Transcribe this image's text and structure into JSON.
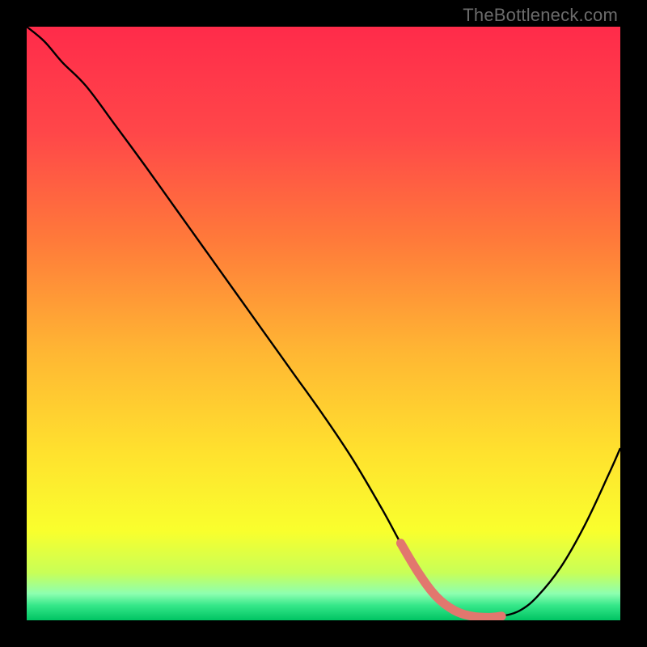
{
  "watermark": "TheBottleneck.com",
  "colors": {
    "background": "#000000",
    "curve": "#000000",
    "highlight": "#e2776e",
    "gradient_stops": [
      {
        "offset": 0.0,
        "color": "#ff2b4a"
      },
      {
        "offset": 0.18,
        "color": "#ff4749"
      },
      {
        "offset": 0.36,
        "color": "#ff7a3a"
      },
      {
        "offset": 0.55,
        "color": "#ffb733"
      },
      {
        "offset": 0.72,
        "color": "#ffe22e"
      },
      {
        "offset": 0.85,
        "color": "#f9ff2d"
      },
      {
        "offset": 0.92,
        "color": "#c8ff57"
      },
      {
        "offset": 0.955,
        "color": "#8dffb0"
      },
      {
        "offset": 0.975,
        "color": "#35e789"
      },
      {
        "offset": 1.0,
        "color": "#00c463"
      }
    ],
    "watermark_text": "#6b6b6b"
  },
  "chart_data": {
    "type": "line",
    "title": "",
    "xlabel": "",
    "ylabel": "",
    "xlim": [
      0,
      100
    ],
    "ylim": [
      0,
      100
    ],
    "series": [
      {
        "name": "curve",
        "x": [
          0,
          3,
          6,
          10,
          15,
          20,
          25,
          30,
          35,
          40,
          45,
          50,
          55,
          60,
          63,
          66,
          69,
          72,
          75,
          78,
          80,
          83,
          86,
          90,
          94,
          98,
          100
        ],
        "y": [
          100,
          97.5,
          94,
          90,
          83.3,
          76.5,
          69.5,
          62.5,
          55.5,
          48.5,
          41.5,
          34.5,
          27,
          18.5,
          13,
          8,
          4,
          1.7,
          0.7,
          0.5,
          0.7,
          1.6,
          4,
          9,
          16,
          24.5,
          29
        ]
      }
    ],
    "highlight_range": {
      "x_start": 63,
      "x_end": 82,
      "y": 0.5
    }
  }
}
